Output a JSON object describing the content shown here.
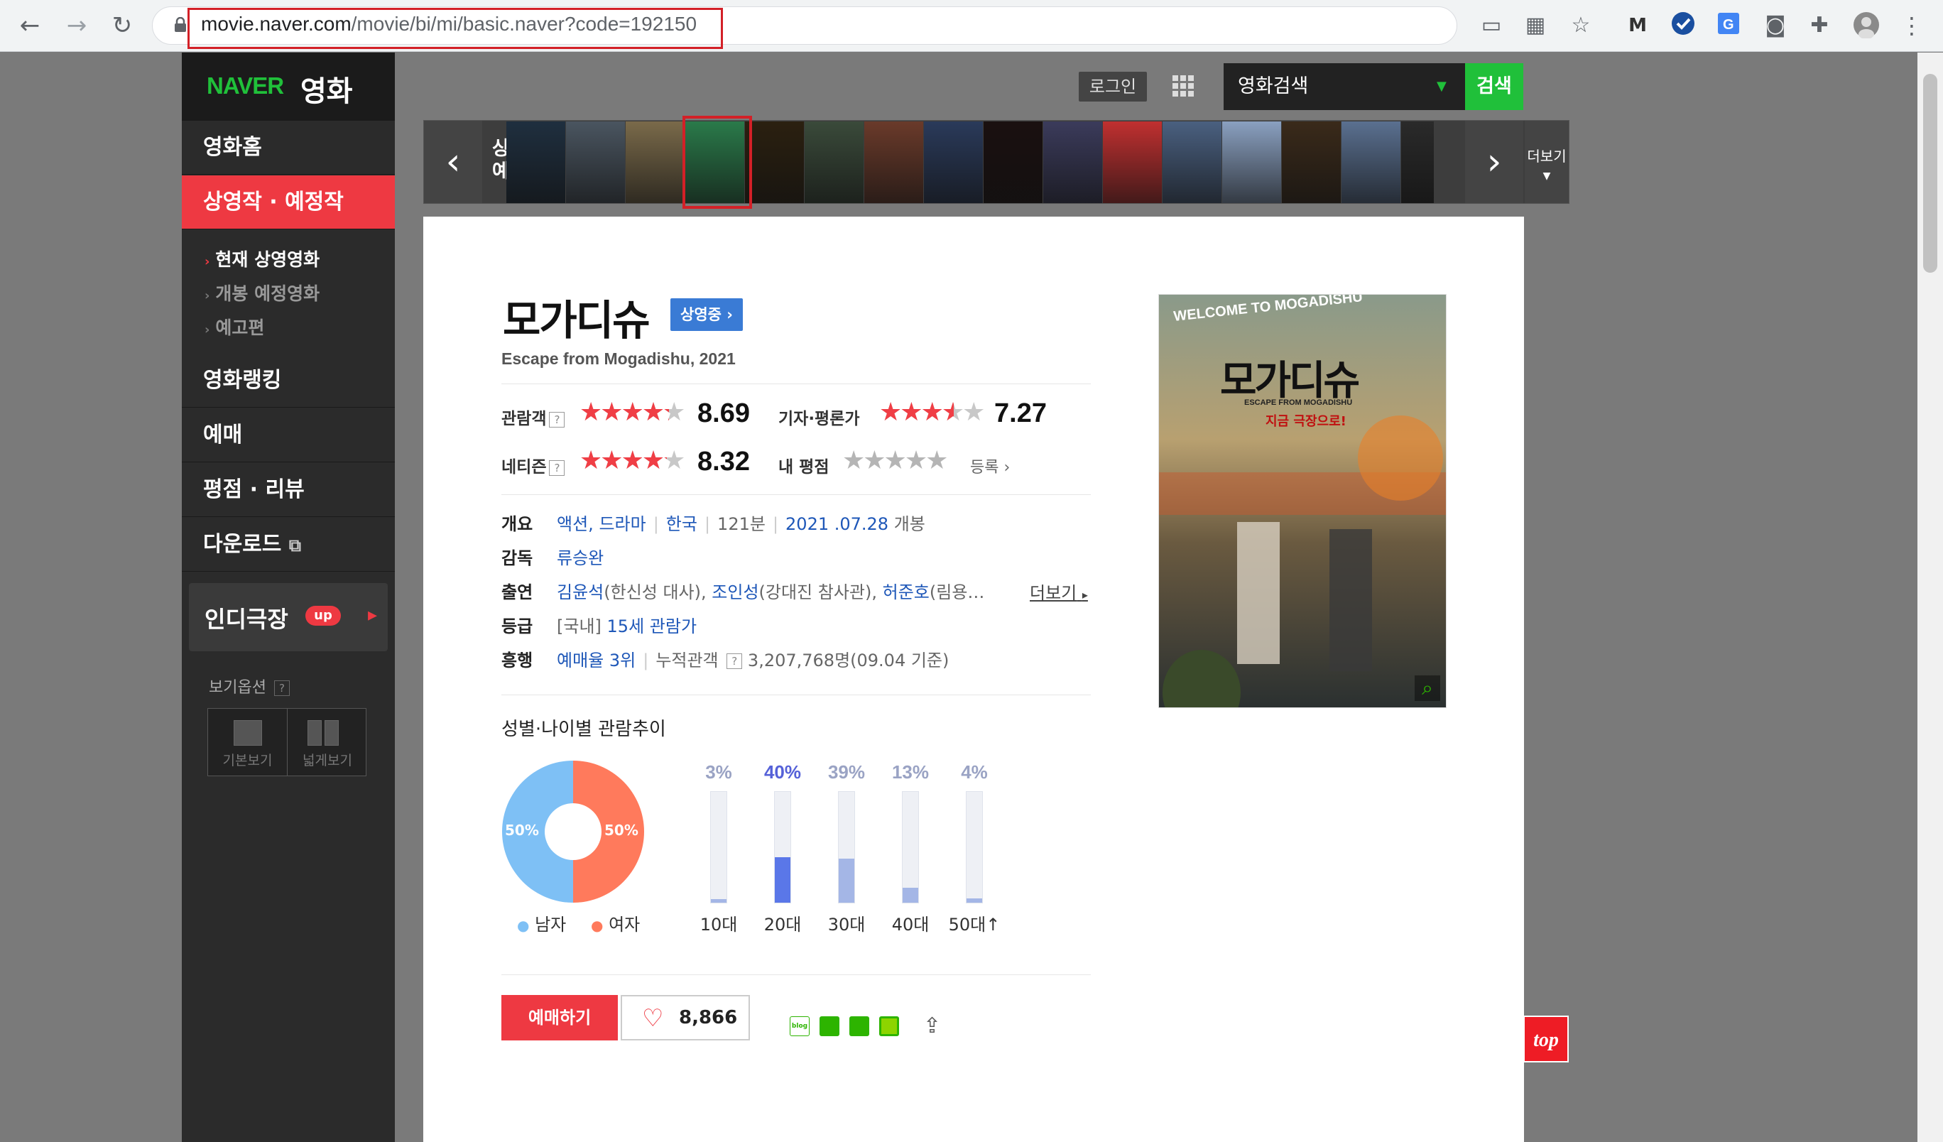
{
  "browser": {
    "url_host": "movie.naver.com",
    "url_path": "/movie/bi/mi/basic.naver?code=192150"
  },
  "header": {
    "logo_naver": "NAVER",
    "logo_kor": "영화",
    "login_label": "로그인",
    "search_select": "영화검색",
    "search_button": "검색"
  },
  "sidebar": {
    "items": [
      {
        "label": "영화홈"
      },
      {
        "label": "상영작 · 예정작"
      },
      {
        "label": "영화랭킹"
      },
      {
        "label": "예매"
      },
      {
        "label": "평점 · 리뷰"
      },
      {
        "label": "다운로드"
      }
    ],
    "sub_items": [
      {
        "label": "현재 상영영화"
      },
      {
        "label": "개봉 예정영화"
      },
      {
        "label": "예고편"
      }
    ],
    "indie_label": "인디극장",
    "indie_badge": "up",
    "view_option_title": "보기옵션",
    "view_basic": "기본보기",
    "view_wide": "넓게보기"
  },
  "strip": {
    "title_line1": "상영작",
    "title_line2": "예매순위",
    "more_label": "더보기",
    "poster_colors": [
      "#1f2f3f",
      "#4a5560",
      "#7a6a4a",
      "#2a7a4a",
      "#2b2010",
      "#3a4a3a",
      "#6a3a2a",
      "#2a3a5a",
      "#1a1010",
      "#3b3b5b",
      "#c03030",
      "#4a6080",
      "#8aa0c0",
      "#3a2a1a",
      "#5a7090",
      "#2a2a2a"
    ]
  },
  "movie": {
    "title": "모가디슈",
    "status_badge": "상영중",
    "subtitle": "Escape from Mogadishu, 2021",
    "audience_label": "관람객",
    "audience_score": "8.69",
    "audience_stars": 4.3,
    "critic_label": "기자·평론가",
    "critic_score": "7.27",
    "critic_stars": 3.6,
    "netizen_label": "네티즌",
    "netizen_score": "8.32",
    "netizen_stars": 4.2,
    "my_rating_label": "내 평점",
    "register_label": "등록",
    "info": {
      "overview_label": "개요",
      "genre1": "액션",
      "genre2": "드라마",
      "country": "한국",
      "runtime": "121분",
      "release_date": "2021 .07.28",
      "release_suffix": "개봉",
      "director_label": "감독",
      "director": "류승완",
      "cast_label": "출연",
      "cast1": "김윤석",
      "cast1_role": "(한신성 대사),",
      "cast2": "조인성",
      "cast2_role": "(강대진 참사관),",
      "cast3": "허준호",
      "cast3_role": "(림용…",
      "more_label": "더보기",
      "rating_label": "등급",
      "rating_prefix": "[국내]",
      "rating": "15세 관람가",
      "boxoffice_label": "흥행",
      "booking_rank": "예매율 3위",
      "cumulative_label": "누적관객",
      "cumulative_value": "3,207,768명(09.04 기준)"
    }
  },
  "demographics": {
    "title": "성별·나이별 관람추이",
    "gender": {
      "male_pct": "50%",
      "female_pct": "50%",
      "male_label": "남자",
      "female_label": "여자"
    },
    "ages": [
      {
        "label": "10대",
        "pct": "3%",
        "value": 3
      },
      {
        "label": "20대",
        "pct": "40%",
        "value": 40
      },
      {
        "label": "30대",
        "pct": "39%",
        "value": 39
      },
      {
        "label": "40대",
        "pct": "13%",
        "value": 13
      },
      {
        "label": "50대↑",
        "pct": "4%",
        "value": 4
      }
    ]
  },
  "actions": {
    "reserve_label": "예매하기",
    "like_count": "8,866",
    "top_label": "top"
  },
  "poster": {
    "welcome_text": "WELCOME TO MOGADISHU",
    "title_text": "모가디슈",
    "eng_text": "ESCAPE FROM MOGADISHU",
    "tagline": "지금 극장으로!"
  }
}
